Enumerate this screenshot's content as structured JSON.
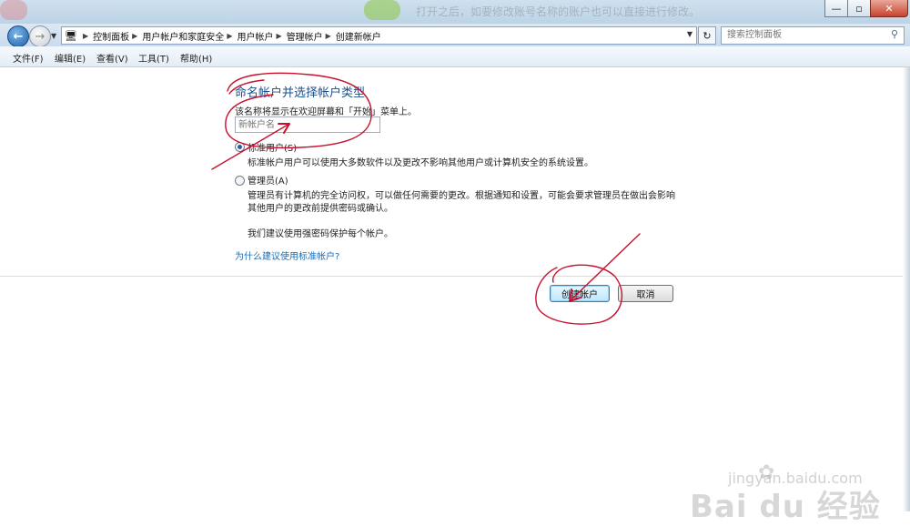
{
  "window": {
    "minimize_icon": "minimize-icon",
    "maximize_icon": "maximize-icon",
    "close_icon": "close-icon",
    "background_text": "打开之后，如要修改账号名称的账户也可以直接进行修改。"
  },
  "nav": {
    "breadcrumbs": [
      "控制面板",
      "用户帐户和家庭安全",
      "用户帐户",
      "管理帐户",
      "创建新帐户"
    ],
    "search_placeholder": "搜索控制面板"
  },
  "menu": {
    "items": [
      "文件(F)",
      "编辑(E)",
      "查看(V)",
      "工具(T)",
      "帮助(H)"
    ]
  },
  "page": {
    "title": "命名帐户并选择帐户类型",
    "subtitle": "该名称将显示在欢迎屏幕和「开始」菜单上。",
    "name_placeholder": "新帐户名",
    "options": [
      {
        "label": "标准用户(S)",
        "checked": true,
        "description": "标准帐户用户可以使用大多数软件以及更改不影响其他用户或计算机安全的系统设置。"
      },
      {
        "label": "管理员(A)",
        "checked": false,
        "description_line1": "管理员有计算机的完全访问权，可以做任何需要的更改。根据通知和设置，可能会要求管理员在做出会影响",
        "description_line2": "其他用户的更改前提供密码或确认。"
      }
    ],
    "recommendation": "我们建议使用强密码保护每个帐户。",
    "help_link": "为什么建议使用标准帐户?",
    "create_button": "创建帐户",
    "cancel_button": "取消"
  },
  "watermark": {
    "logo": "Bai du 经验",
    "url": "jingyan.baidu.com"
  },
  "colors": {
    "heading": "#1b4f8c",
    "link": "#1d6bb0",
    "annotation": "#c8102e"
  }
}
